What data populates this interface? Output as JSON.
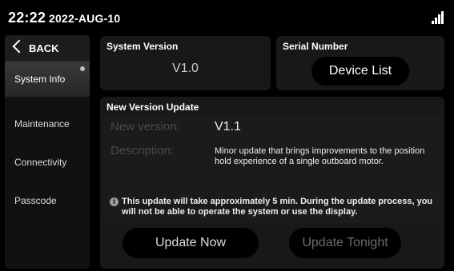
{
  "status": {
    "time": "22:22",
    "date": "2022-AUG-10",
    "signal_icon": "signal-bars-icon"
  },
  "sidebar": {
    "back_label": "BACK",
    "items": [
      {
        "label": "System Info",
        "active": true
      },
      {
        "label": "Maintenance"
      },
      {
        "label": "Connectivity"
      },
      {
        "label": "Passcode"
      }
    ]
  },
  "system_version": {
    "title": "System Version",
    "value": "V1.0"
  },
  "serial_number": {
    "title": "Serial Number",
    "button_label": "Device List"
  },
  "update": {
    "title": "New Version Update",
    "new_version_label": "New version:",
    "new_version_value": "V1.1",
    "description_label": "Description:",
    "description_value": "Minor update that brings improvements to the position hold experience of a single outboard motor.",
    "notice": "This update will take approximately 5 min. During the update process, you will not be able to operate the system or use the display.",
    "update_now_label": "Update Now",
    "update_tonight_label": "Update Tonight"
  },
  "colors": {
    "background": "#000000",
    "panel": "#181818",
    "muted_text": "#4a4a4a",
    "active_nav": "#333333"
  }
}
